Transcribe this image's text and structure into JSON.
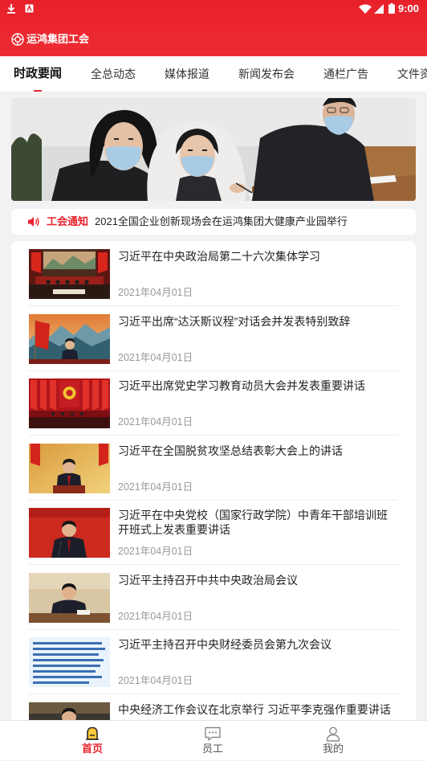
{
  "status_bar": {
    "time": "9:00",
    "left_icons": [
      "download-icon",
      "app-notification-icon"
    ],
    "right_icons": [
      "wifi-icon",
      "signal-icon",
      "battery-icon"
    ]
  },
  "header": {
    "logo_icon": "union-emblem-icon",
    "title": "运鸿集团工会"
  },
  "tabs": [
    {
      "label": "时政要闻",
      "active": true
    },
    {
      "label": "全总动态",
      "active": false
    },
    {
      "label": "媒体报道",
      "active": false
    },
    {
      "label": "新闻发布会",
      "active": false
    },
    {
      "label": "通栏广告",
      "active": false
    },
    {
      "label": "文件资",
      "active": false
    }
  ],
  "notice": {
    "icon": "speaker-icon",
    "label": "工会通知",
    "text": "2021全国企业创新现场会在运鸿集团大健康产业园举行"
  },
  "news": [
    {
      "title": "习近平在中央政治局第二十六次集体学习",
      "date": "2021年04月01日"
    },
    {
      "title": "习近平出席“达沃斯议程”对话会并发表特别致辞",
      "date": "2021年04月01日"
    },
    {
      "title": "习近平出席党史学习教育动员大会并发表重要讲话",
      "date": "2021年04月01日"
    },
    {
      "title": "习近平在全国脱贫攻坚总结表彰大会上的讲话",
      "date": "2021年04月01日"
    },
    {
      "title": "习近平在中央党校（国家行政学院）中青年干部培训班开班式上发表重要讲话",
      "date": "2021年04月01日"
    },
    {
      "title": "习近平主持召开中共中央政治局会议",
      "date": "2021年04月01日"
    },
    {
      "title": "习近平主持召开中央财经委员会第九次会议",
      "date": "2021年04月01日"
    },
    {
      "title": "中央经济工作会议在北京举行 习近平李克强作重要讲话"
    }
  ],
  "bottom_nav": [
    {
      "label": "首页",
      "icon": "home-icon",
      "active": true
    },
    {
      "label": "员工",
      "icon": "chat-icon",
      "active": false
    },
    {
      "label": "我的",
      "icon": "user-icon",
      "active": false
    }
  ],
  "colors": {
    "accent": "#e8232c",
    "background": "#f2f2f2",
    "text": "#222222",
    "muted": "#999999"
  }
}
